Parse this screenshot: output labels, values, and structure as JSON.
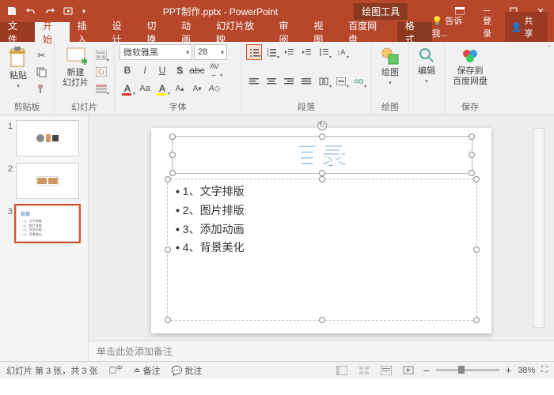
{
  "app": {
    "doc_title": "PPT制作.pptx - PowerPoint",
    "context_tab": "绘图工具"
  },
  "tabs": {
    "file": "文件",
    "home": "开始",
    "insert": "插入",
    "design": "设计",
    "transitions": "切换",
    "animations": "动画",
    "slideshow": "幻灯片放映",
    "review": "审阅",
    "view": "视图",
    "baidu": "百度网盘",
    "format": "格式",
    "tell_me": "告诉我...",
    "signin": "登录",
    "share": "共享"
  },
  "ribbon": {
    "clipboard": {
      "paste": "粘贴",
      "label": "剪贴板"
    },
    "slides": {
      "new_slide": "新建\n幻灯片",
      "label": "幻灯片"
    },
    "font": {
      "family": "微软雅黑",
      "size": "28",
      "label": "字体"
    },
    "paragraph": {
      "label": "段落"
    },
    "drawing": {
      "draw": "绘图",
      "label": "绘图"
    },
    "editing": {
      "edit": "编辑"
    },
    "save": {
      "save_to": "保存到\n百度网盘",
      "label": "保存"
    }
  },
  "thumbs": [
    1,
    2,
    3
  ],
  "slide": {
    "title": "目录",
    "bullets": [
      "1、文字排版",
      "2、图片排版",
      "3、添加动画",
      "4、背景美化"
    ]
  },
  "notes_placeholder": "单击此处添加备注",
  "status": {
    "slide_info": "幻灯片 第 3 张，共 3 张",
    "lang": "",
    "notes": "备注",
    "comments": "批注",
    "zoom": "38%"
  }
}
